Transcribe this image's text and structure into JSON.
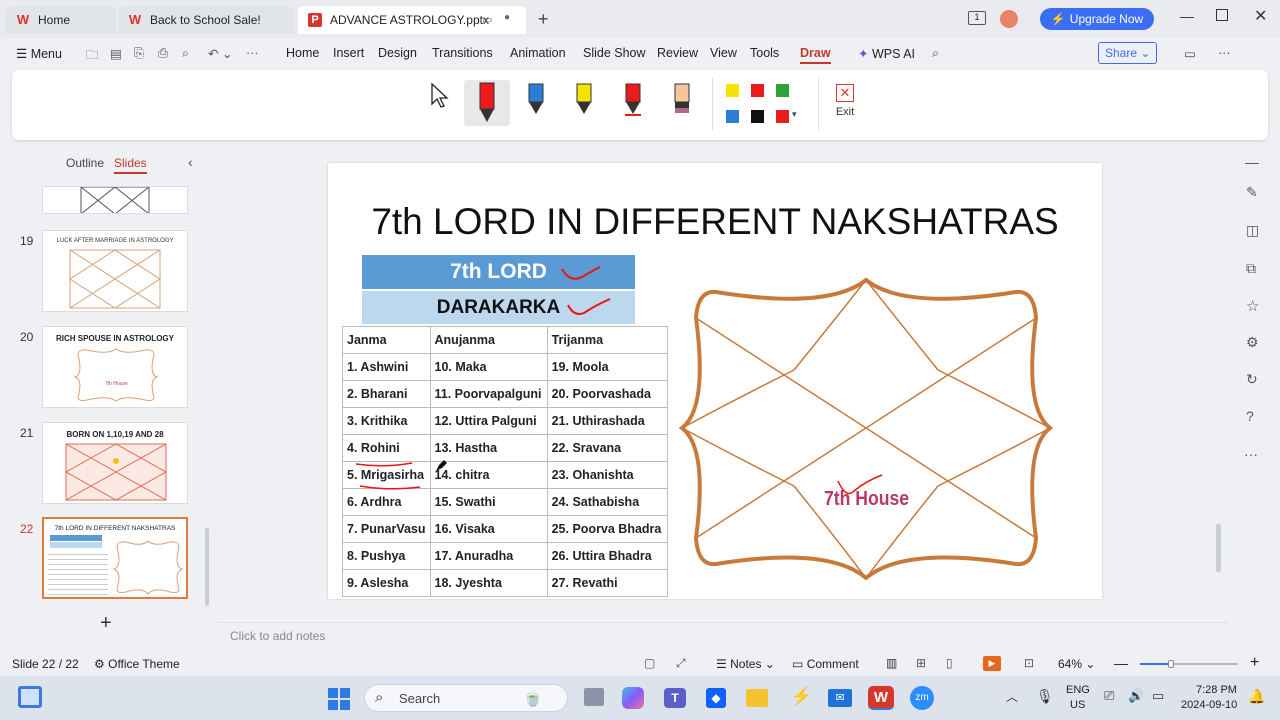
{
  "tabs": [
    {
      "label": "Home"
    },
    {
      "label": "Back to School Sale!"
    },
    {
      "label": "ADVANCE ASTROLOGY.pptx"
    }
  ],
  "upgrade_label": "Upgrade Now",
  "menu": {
    "menu_label": "Menu",
    "items": [
      "Home",
      "Insert",
      "Design",
      "Transitions",
      "Animation",
      "Slide Show",
      "Review",
      "View",
      "Tools",
      "Draw"
    ],
    "wps_ai": "WPS AI",
    "share": "Share"
  },
  "ribbon": {
    "exit_label": "Exit",
    "colors": [
      "#f5e400",
      "#e81c1c",
      "#2aa33a",
      "#2a7fd4",
      "#111111",
      "#e81c1c"
    ]
  },
  "panel": {
    "outline_tab": "Outline",
    "slides_tab": "Slides"
  },
  "thumbs": [
    {
      "num": "19",
      "title": "LUCK AFTER MARRIAGE IN ASTROLOGY"
    },
    {
      "num": "20",
      "title": "RICH SPOUSE IN ASTROLOGY",
      "sub": "7th House"
    },
    {
      "num": "21",
      "title": "BORN ON 1,10,19 AND 28"
    },
    {
      "num": "22",
      "title": "7th LORD IN DIFFERENT NAKSHATRAS"
    }
  ],
  "slide": {
    "title": "7th LORD IN DIFFERENT NAKSHATRAS",
    "box1": "7th LORD",
    "box2": "DARAKARKA",
    "headers": [
      "Janma",
      "Anujanma",
      "Trijanma"
    ],
    "rows": [
      [
        "1. Ashwini",
        "10. Maka",
        "19. Moola"
      ],
      [
        "2. Bharani",
        "11. Poorvapalguni",
        "20. Poorvashada"
      ],
      [
        "3. Krithika",
        "12. Uttira Palguni",
        "21. Uthirashada"
      ],
      [
        "4. Rohini",
        "13. Hastha",
        "22. Sravana"
      ],
      [
        "5. Mrigasirha",
        "14. chitra",
        "23. Ohanishta"
      ],
      [
        "6. Ardhra",
        "15. Swathi",
        "24. Sathabisha"
      ],
      [
        "7. PunarVasu",
        "16. Visaka",
        "25. Poorva Bhadra"
      ],
      [
        "8. Pushya",
        "17. Anuradha",
        "26. Uttira Bhadra"
      ],
      [
        "9. Aslesha",
        "18. Jyeshta",
        "27. Revathi"
      ]
    ],
    "house_label": "7th House"
  },
  "notes_placeholder": "Click to add notes",
  "status": {
    "slide_count": "Slide 22 / 22",
    "theme": "Office Theme",
    "notes": "Notes",
    "comment": "Comment",
    "zoom": "64%"
  },
  "taskbar": {
    "search": "Search",
    "lang1": "ENG",
    "lang2": "US",
    "time": "7:28 PM",
    "date": "2024-09-10"
  }
}
